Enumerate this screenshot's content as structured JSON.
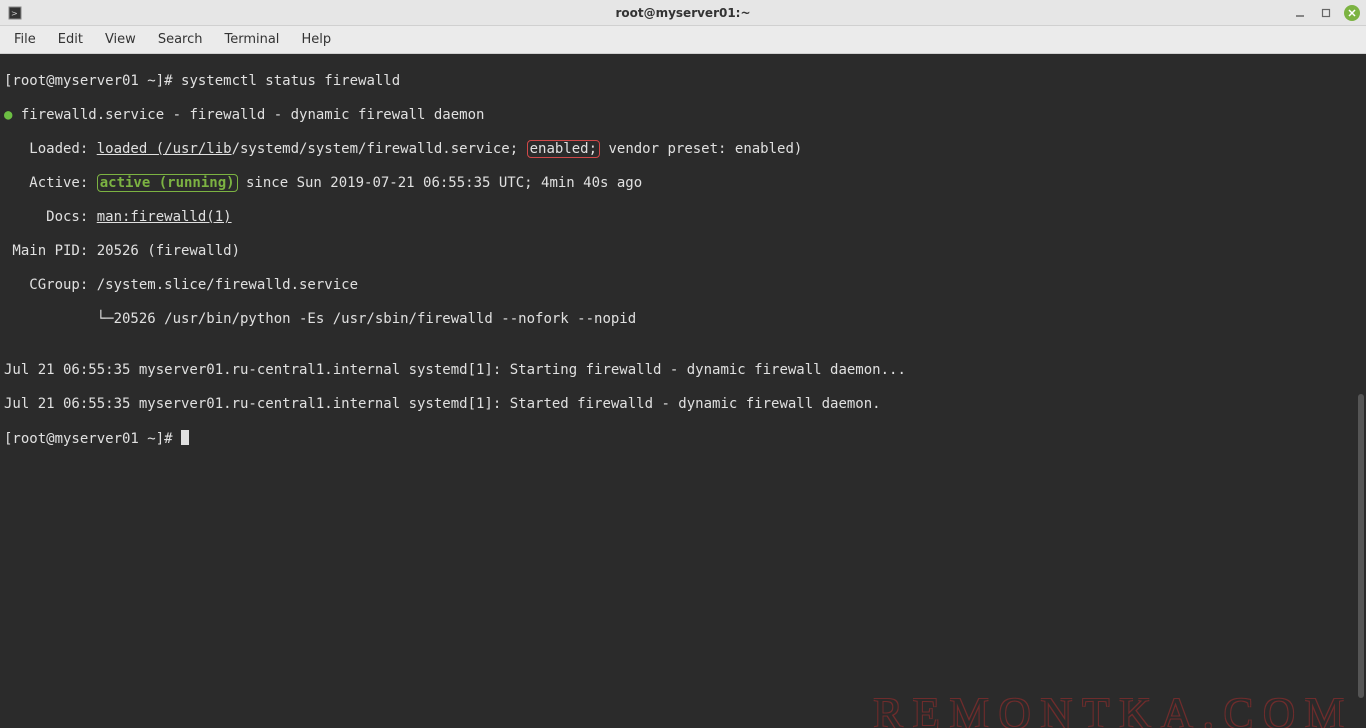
{
  "titlebar": {
    "title": "root@myserver01:~"
  },
  "menu": {
    "items": [
      "File",
      "Edit",
      "View",
      "Search",
      "Terminal",
      "Help"
    ]
  },
  "prompt1": "[root@myserver01 ~]# ",
  "command": "systemctl status firewalld",
  "l2_bullet": "●",
  "l2": " firewalld.service - firewalld - dynamic firewall daemon",
  "l3_a": "   Loaded: ",
  "l3_u": "loaded (/usr/lib",
  "l3_b": "/systemd/system/firewalld.service; ",
  "l3_enabled": "enabled;",
  "l3_c": " vendor preset: enabled)",
  "l4_a": "   Active: ",
  "l4_active": "active (running)",
  "l4_b": " since Sun 2019-07-21 06:55:35 UTC; 4min 40s ago",
  "l5_a": "     Docs: ",
  "l5_u": "man:firewalld(1)",
  "l6": " Main PID: 20526 (firewalld)",
  "l7": "   CGroup: /system.slice/firewalld.service",
  "l8": "           └─20526 /usr/bin/python -Es /usr/sbin/firewalld --nofork --nopid",
  "l9": "",
  "l10": "Jul 21 06:55:35 myserver01.ru-central1.internal systemd[1]: Starting firewalld - dynamic firewall daemon...",
  "l11": "Jul 21 06:55:35 myserver01.ru-central1.internal systemd[1]: Started firewalld - dynamic firewall daemon.",
  "prompt2": "[root@myserver01 ~]# ",
  "watermark": "REMONTKA.COM"
}
